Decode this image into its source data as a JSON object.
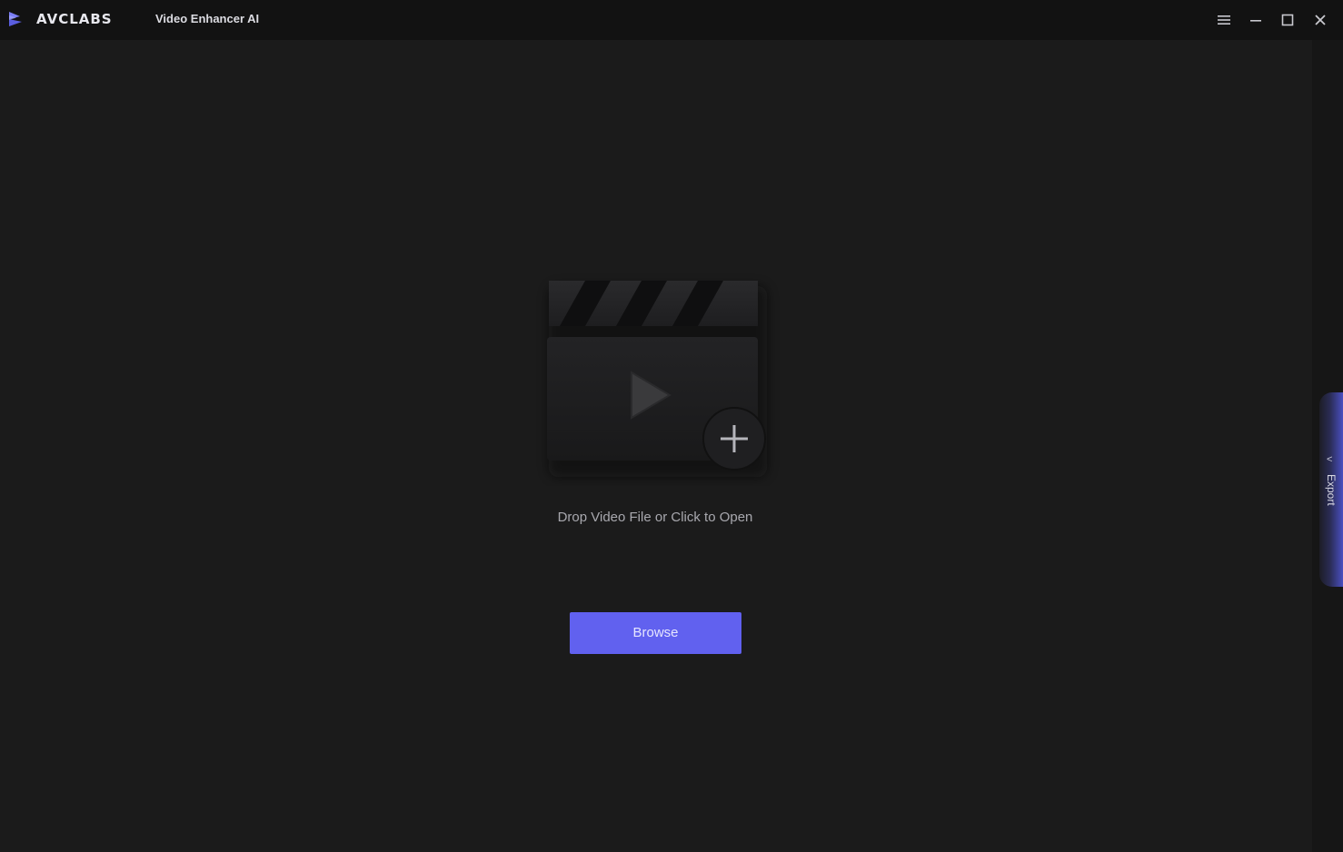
{
  "window": {
    "brand": "AVCLABS",
    "product": "Video Enhancer AI"
  },
  "titlebar_icons": [
    "menu-icon",
    "minimize-icon",
    "maximize-icon",
    "close-icon"
  ],
  "main": {
    "drop_text": "Drop Video File or Click to Open",
    "browse_label": "Browse"
  },
  "side_panel": {
    "export_label": "Export",
    "chevron": "<"
  },
  "colors": {
    "background": "#1b1b1b",
    "titlebar": "#121212",
    "accent": "#6161ef"
  }
}
